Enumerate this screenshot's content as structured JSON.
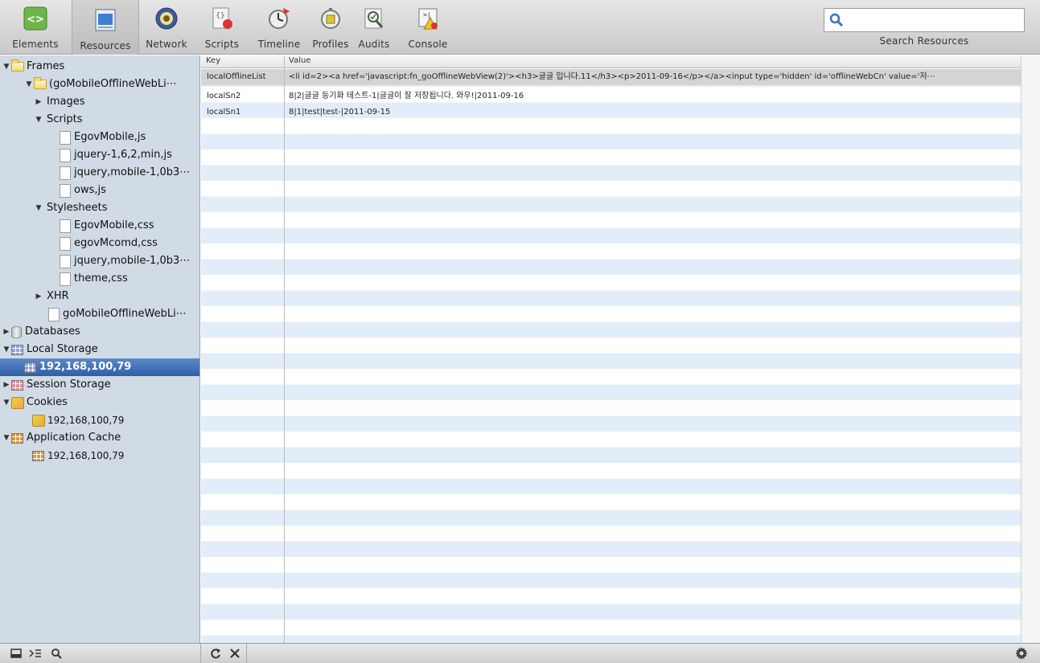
{
  "toolbar": {
    "items": [
      {
        "label": "Elements",
        "icon": "elements-icon"
      },
      {
        "label": "Resources",
        "icon": "resources-icon"
      },
      {
        "label": "Network",
        "icon": "network-icon"
      },
      {
        "label": "Scripts",
        "icon": "scripts-icon"
      },
      {
        "label": "Timeline",
        "icon": "timeline-icon"
      },
      {
        "label": "Profiles",
        "icon": "profiles-icon"
      },
      {
        "label": "Audits",
        "icon": "audits-icon"
      },
      {
        "label": "Console",
        "icon": "console-icon"
      }
    ],
    "active": "Resources",
    "search_value": "",
    "search_caption": "Search Resources"
  },
  "sidebar": {
    "frames_label": "Frames",
    "frame_label": "(goMobileOfflineWebLi⋯",
    "images_label": "Images",
    "scripts_label": "Scripts",
    "scripts": [
      "EgovMobile,js",
      "jquery-1,6,2,min,js",
      "jquery,mobile-1,0b3⋯",
      "ows,js"
    ],
    "stylesheets_label": "Stylesheets",
    "stylesheets": [
      "EgovMobile,css",
      "egovMcomd,css",
      "jquery,mobile-1,0b3⋯",
      "theme,css"
    ],
    "xhr_label": "XHR",
    "document_label": "goMobileOfflineWebLi⋯",
    "databases_label": "Databases",
    "local_storage_label": "Local Storage",
    "local_storage_host": "192,168,100,79",
    "session_storage_label": "Session Storage",
    "cookies_label": "Cookies",
    "cookies_host": "192,168,100,79",
    "app_cache_label": "Application Cache",
    "app_cache_host": "192,168,100,79"
  },
  "table": {
    "columns": [
      "Key",
      "Value"
    ],
    "rows": [
      {
        "key": "localOfflineList",
        "value": "<li id=2><a href='javascript:fn_goOfflineWebView(2)'><h3>글글 입니다.11</h3><p>2011-09-16</p></a><input type='hidden' id='offlineWebCn' value='저⋯"
      },
      {
        "key": "localSn2",
        "value": "8|2|글글 등기화 테스트-1|글글이 잘 저장됩니다. 와우!|2011-09-16"
      },
      {
        "key": "localSn1",
        "value": "8|1|test|test-|2011-09-15"
      }
    ]
  },
  "statusbar": {
    "buttons": [
      "dock-icon",
      "console-toggle-icon",
      "search-icon",
      "refresh-icon",
      "delete-icon",
      "settings-icon"
    ]
  },
  "colors": {
    "sidebar_bg": "#d1dbe5",
    "selection": "#2e5fa8",
    "row_stripe": "#e2edfa"
  }
}
